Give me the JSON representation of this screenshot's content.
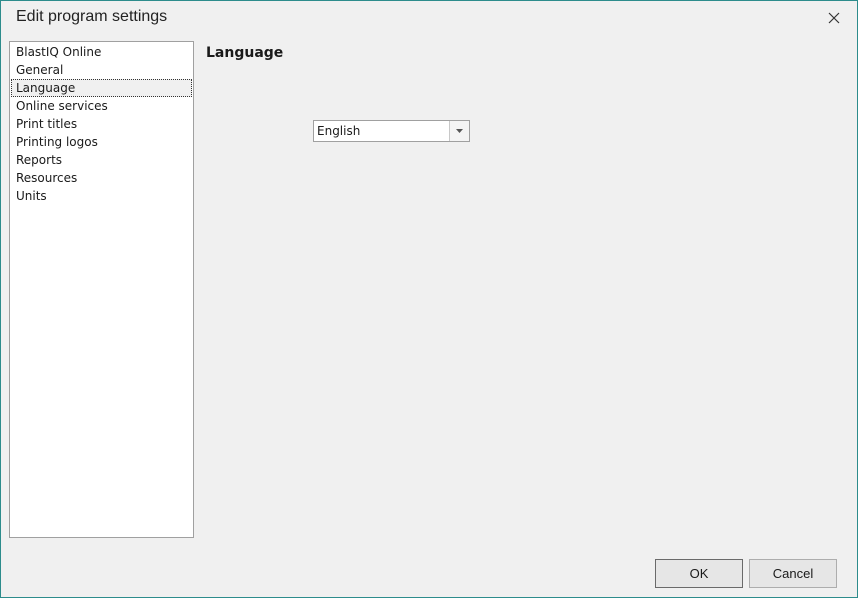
{
  "window": {
    "title": "Edit program settings"
  },
  "nav": {
    "items": [
      {
        "label": "BlastIQ Online"
      },
      {
        "label": "General"
      },
      {
        "label": "Language"
      },
      {
        "label": "Online services"
      },
      {
        "label": "Print titles"
      },
      {
        "label": "Printing logos"
      },
      {
        "label": "Reports"
      },
      {
        "label": "Resources"
      },
      {
        "label": "Units"
      }
    ],
    "selected_index": 2
  },
  "content": {
    "section_title": "Language",
    "language_select": {
      "value": "English"
    }
  },
  "footer": {
    "ok_label": "OK",
    "cancel_label": "Cancel"
  },
  "icons": {
    "close": "close-icon",
    "dropdown": "chevron-down-icon"
  },
  "colors": {
    "window_border": "#2d8c8c",
    "background": "#f0f0f0"
  }
}
